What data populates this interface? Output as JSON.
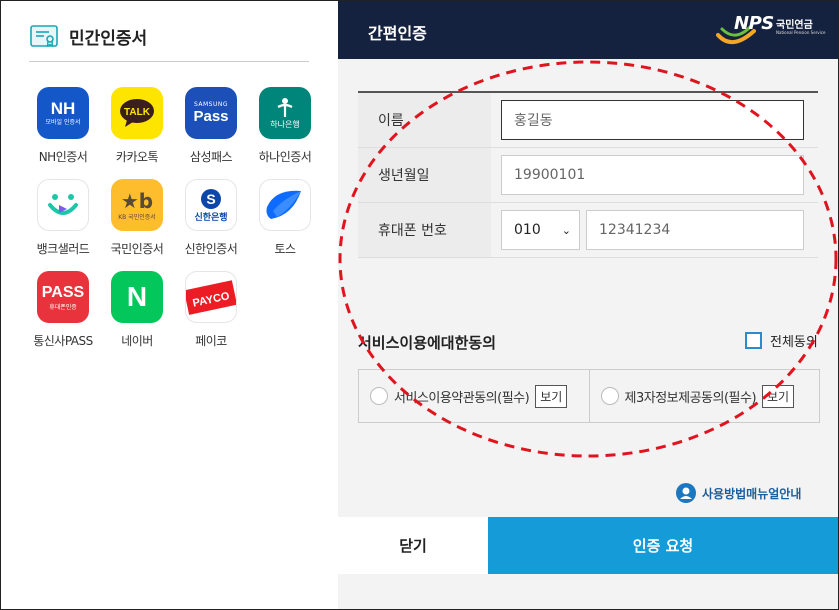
{
  "left": {
    "title": "민간인증서",
    "apps": [
      {
        "label": "NH인증서",
        "icon": "nh-icon",
        "bg": "#1457c8",
        "line1": "NH",
        "line2": "모바일 인증서"
      },
      {
        "label": "카카오톡",
        "icon": "kakaotalk-icon",
        "bg": "#fee500",
        "line1": "TALK",
        "line2": ""
      },
      {
        "label": "삼성패스",
        "icon": "samsung-pass-icon",
        "bg": "#1c4fb8",
        "line1": "SAMSUNG",
        "line2": "Pass"
      },
      {
        "label": "하나인증서",
        "icon": "hana-icon",
        "bg": "#00857a",
        "line1": "하나은행",
        "line2": ""
      },
      {
        "label": "뱅크샐러드",
        "icon": "banksalad-icon",
        "bg": "#ffffff",
        "line1": "",
        "line2": ""
      },
      {
        "label": "국민인증서",
        "icon": "kb-icon",
        "bg": "#fdbd2c",
        "line1": "KB 국민인증서",
        "line2": ""
      },
      {
        "label": "신한인증서",
        "icon": "shinhan-icon",
        "bg": "#ffffff",
        "line1": "신한은행",
        "line2": ""
      },
      {
        "label": "토스",
        "icon": "toss-icon",
        "bg": "#ffffff",
        "line1": "",
        "line2": ""
      },
      {
        "label": "통신사PASS",
        "icon": "pass-icon",
        "bg": "#e8323c",
        "line1": "PASS",
        "line2": "휴대폰인증"
      },
      {
        "label": "네이버",
        "icon": "naver-icon",
        "bg": "#03c75a",
        "line1": "N",
        "line2": ""
      },
      {
        "label": "페이코",
        "icon": "payco-icon",
        "bg": "#ffffff",
        "line1": "PAYCO",
        "line2": ""
      }
    ]
  },
  "right": {
    "title": "간편인증",
    "logo": {
      "text": "NPS",
      "kr": "국민연금",
      "en": "National Pension Service"
    },
    "form": {
      "name_label": "이름",
      "name_placeholder": "홍길동",
      "birth_label": "생년월일",
      "birth_placeholder": "19900101",
      "phone_label": "휴대폰 번호",
      "phone_prefix": "010",
      "phone_placeholder": "12341234"
    },
    "agree": {
      "title": "서비스이용에대한동의",
      "all_label": "전체동의",
      "items": [
        {
          "label": "서비스이용약관동의(필수)",
          "button": "보기"
        },
        {
          "label": "제3자정보제공동의(필수)",
          "button": "보기"
        }
      ]
    },
    "manual_label": "사용방법매뉴얼안내",
    "close_label": "닫기",
    "request_label": "인증 요청"
  },
  "colors": {
    "header": "#15223f",
    "primary": "#159bd7",
    "annotation": "#e0141e"
  }
}
